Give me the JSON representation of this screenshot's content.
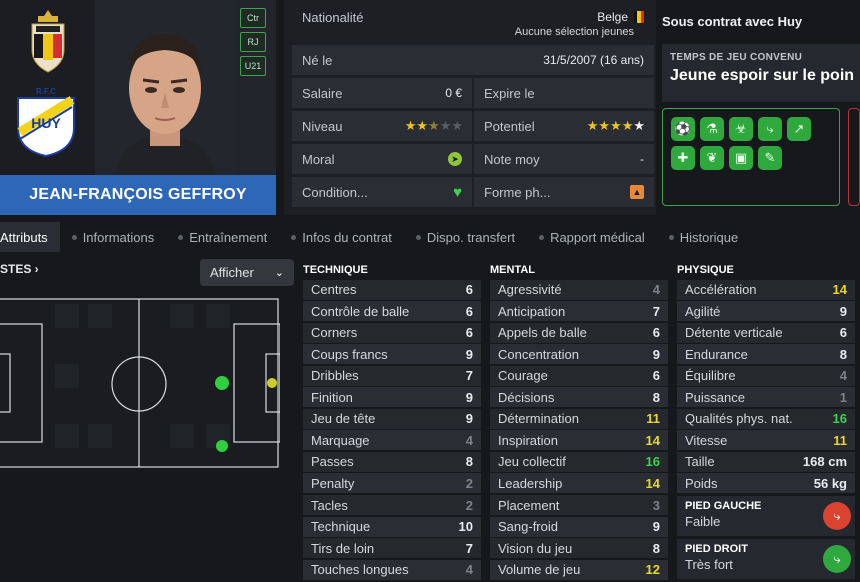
{
  "player": {
    "name": "JEAN-FRANÇOIS GEFFROY",
    "positions": [
      "Ctr",
      "RJ",
      "U21"
    ]
  },
  "info": {
    "nationalite_label": "Nationalité",
    "nationalite_value": "Belge",
    "selection_note": "Aucune sélection jeunes",
    "ne_le_label": "Né le",
    "ne_le_value": "31/5/2007 (16 ans)",
    "salaire_label": "Salaire",
    "salaire_value": "0 €",
    "expire_label": "Expire le",
    "expire_value": "",
    "niveau_label": "Niveau",
    "niveau_stars": 2,
    "potentiel_label": "Potentiel",
    "potentiel_stars": 5,
    "moral_label": "Moral",
    "note_moy_label": "Note moy",
    "note_moy_value": "-",
    "condition_label": "Condition...",
    "forme_label": "Forme ph..."
  },
  "contract": {
    "title": "Sous contrat avec Huy",
    "playtime_label": "TEMPS DE JEU CONVENU",
    "playtime_value": "Jeune espoir sur le poin"
  },
  "traits": [
    "ball-foot-icon",
    "flask-icon",
    "biohazard-icon",
    "boot-icon",
    "trend-up-icon",
    "bandage-icon",
    "leaf-icon",
    "money-icon",
    "contract-icon"
  ],
  "tabs": [
    "Attributs",
    "Informations",
    "Entraînement",
    "Infos du contrat",
    "Dispo. transfert",
    "Rapport médical",
    "Historique"
  ],
  "pitch": {
    "heading": "STES ›",
    "afficher_label": "Afficher"
  },
  "technique": {
    "title": "TECHNIQUE",
    "rows": [
      {
        "name": "Centres",
        "value": "6"
      },
      {
        "name": "Contrôle de balle",
        "value": "6"
      },
      {
        "name": "Corners",
        "value": "6"
      },
      {
        "name": "Coups francs",
        "value": "9"
      },
      {
        "name": "Dribbles",
        "value": "7"
      },
      {
        "name": "Finition",
        "value": "9"
      },
      {
        "name": "Jeu de tête",
        "value": "9"
      },
      {
        "name": "Marquage",
        "value": "4"
      },
      {
        "name": "Passes",
        "value": "8"
      },
      {
        "name": "Penalty",
        "value": "2"
      },
      {
        "name": "Tacles",
        "value": "2"
      },
      {
        "name": "Technique",
        "value": "10"
      },
      {
        "name": "Tirs de loin",
        "value": "7"
      },
      {
        "name": "Touches longues",
        "value": "4"
      }
    ]
  },
  "mental": {
    "title": "MENTAL",
    "rows": [
      {
        "name": "Agressivité",
        "value": "4"
      },
      {
        "name": "Anticipation",
        "value": "7"
      },
      {
        "name": "Appels de balle",
        "value": "6"
      },
      {
        "name": "Concentration",
        "value": "9"
      },
      {
        "name": "Courage",
        "value": "6"
      },
      {
        "name": "Décisions",
        "value": "8"
      },
      {
        "name": "Détermination",
        "value": "11"
      },
      {
        "name": "Inspiration",
        "value": "14"
      },
      {
        "name": "Jeu collectif",
        "value": "16"
      },
      {
        "name": "Leadership",
        "value": "14"
      },
      {
        "name": "Placement",
        "value": "3"
      },
      {
        "name": "Sang-froid",
        "value": "9"
      },
      {
        "name": "Vision du jeu",
        "value": "8"
      },
      {
        "name": "Volume de jeu",
        "value": "12"
      }
    ]
  },
  "physique": {
    "title": "PHYSIQUE",
    "rows": [
      {
        "name": "Accélération",
        "value": "14"
      },
      {
        "name": "Agilité",
        "value": "9"
      },
      {
        "name": "Détente verticale",
        "value": "6"
      },
      {
        "name": "Endurance",
        "value": "8"
      },
      {
        "name": "Équilibre",
        "value": "4"
      },
      {
        "name": "Puissance",
        "value": "1"
      },
      {
        "name": "Qualités phys. nat.",
        "value": "16"
      },
      {
        "name": "Vitesse",
        "value": "11"
      },
      {
        "name": "Taille",
        "value": "168 cm"
      },
      {
        "name": "Poids",
        "value": "56 kg"
      }
    ],
    "pied_gauche_label": "PIED GAUCHE",
    "pied_gauche_value": "Faible",
    "pied_droit_label": "PIED DROIT",
    "pied_droit_value": "Très fort"
  },
  "colors": {
    "low": "#7e8289",
    "mid": "#e9ebee",
    "good": "#e8d82e",
    "great": "#3fd24d",
    "name_bar": "#2f67b8",
    "trait_green": "#2fa83e"
  }
}
